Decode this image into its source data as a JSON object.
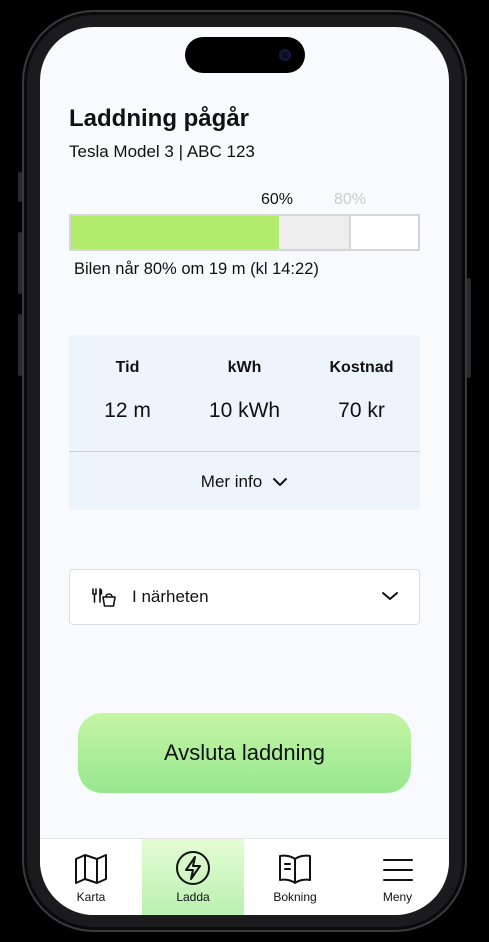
{
  "header": {
    "title": "Laddning pågår",
    "subtitle": "Tesla Model 3 | ABC 123"
  },
  "charge": {
    "current_label": "60%",
    "target_label": "80%",
    "current_fraction": 0.6,
    "target_fraction": 0.8,
    "eta_text": "Bilen når 80% om 19 m (kl 14:22)"
  },
  "stats": {
    "time_header": "Tid",
    "time_value": "12 m",
    "kwh_header": "kWh",
    "kwh_value": "10 kWh",
    "cost_header": "Kostnad",
    "cost_value": "70 kr",
    "more_info_label": "Mer info"
  },
  "nearby": {
    "label": "I närheten"
  },
  "actions": {
    "end_charging_label": "Avsluta laddning"
  },
  "tabs": [
    {
      "label": "Karta",
      "icon": "map-icon",
      "active": false
    },
    {
      "label": "Ladda",
      "icon": "lightning-icon",
      "active": true
    },
    {
      "label": "Bokning",
      "icon": "book-icon",
      "active": false
    },
    {
      "label": "Meny",
      "icon": "hamburger-menu-icon",
      "active": false
    }
  ],
  "colors": {
    "progress_fill": "#b1ec6d",
    "button_gradient_top": "#c4f5a4",
    "button_gradient_bottom": "#97e88f",
    "stats_background": "#eef4fc"
  }
}
